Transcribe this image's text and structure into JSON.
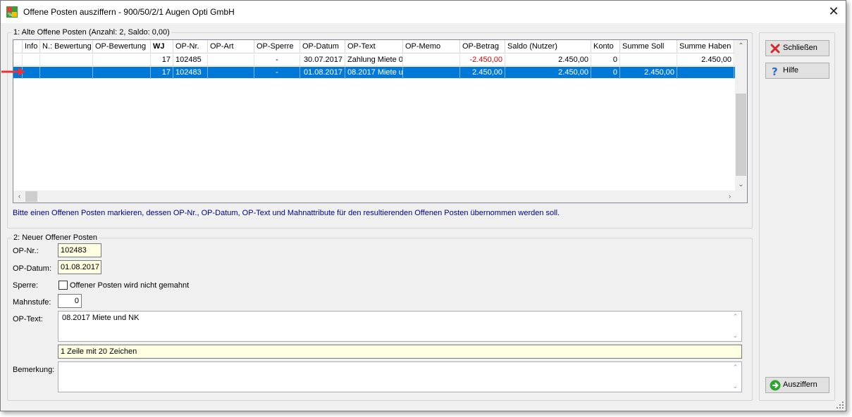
{
  "window": {
    "title": "Offene Posten ausziffern - 900/50/2/1 Augen Opti GmbH",
    "close_glyph": "✕"
  },
  "group1": {
    "label": "1: Alte Offene Posten  (Anzahl: 2,  Saldo: 0,00)",
    "columns": [
      "Info",
      "N.: Bewertung",
      "OP-Bewertung",
      "WJ",
      "OP-Nr.",
      "OP-Art",
      "OP-Sperre",
      "OP-Datum",
      "OP-Text",
      "OP-Memo",
      "OP-Betrag",
      "Saldo (Nutzer)",
      "Konto",
      "Summe Soll",
      "Summe Haben"
    ],
    "rows": [
      {
        "info": "",
        "n_bewertung": "",
        "op_bewertung": "",
        "wj": "17",
        "op_nr": "102485",
        "op_art": "",
        "op_sperre": "-",
        "op_datum": "30.07.2017",
        "op_text": "Zahlung Miete 0",
        "op_memo": "",
        "op_betrag": "-2.450,00",
        "saldo": "2.450,00",
        "konto": "0",
        "summe_soll": "",
        "summe_haben": "2.450,00",
        "selected": false
      },
      {
        "info": "",
        "n_bewertung": "",
        "op_bewertung": "",
        "wj": "17",
        "op_nr": "102483",
        "op_art": "",
        "op_sperre": "-",
        "op_datum": "01.08.2017",
        "op_text": "08.2017 Miete u",
        "op_memo": "",
        "op_betrag": "2.450,00",
        "saldo": "2.450,00",
        "konto": "0",
        "summe_soll": "2.450,00",
        "summe_haben": "",
        "selected": true
      }
    ],
    "hint": "Bitte einen Offenen Posten markieren, dessen OP-Nr., OP-Datum, OP-Text und Mahnattribute für den resultierenden Offenen Posten übernommen werden soll."
  },
  "group2": {
    "label": "2: Neuer Offener Posten",
    "op_nr_label": "OP-Nr.:",
    "op_nr_value": "102483",
    "op_datum_label": "OP-Datum:",
    "op_datum_value": "01.08.2017",
    "sperre_label": "Sperre:",
    "sperre_checkbox_label": "Offener Posten wird nicht gemahnt",
    "mahnstufe_label": "Mahnstufe:",
    "mahnstufe_value": "0",
    "op_text_label": "OP-Text:",
    "op_text_value": "08.2017 Miete und NK",
    "op_text_info": "1 Zeile mit 20 Zeichen",
    "bemerkung_label": "Bemerkung:",
    "bemerkung_value": ""
  },
  "buttons": {
    "close": "Schließen",
    "help": "Hilfe",
    "reconcile": "Ausziffern"
  },
  "colors": {
    "selection": "#0078d7",
    "negative": "#e00000",
    "hint_text": "#000080",
    "field_yellow": "#ffffe1",
    "marker_arrow": "#e8323c"
  }
}
